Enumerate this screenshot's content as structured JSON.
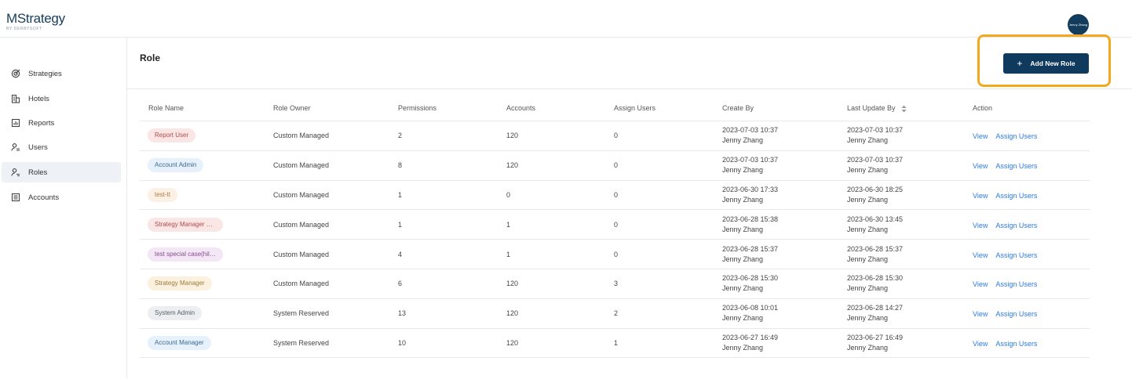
{
  "header": {
    "logo_text": "MStrategy",
    "logo_sub": "BY DERBYSOFT",
    "avatar_text": "Jenny Zhang"
  },
  "sidebar": {
    "items": [
      {
        "label": "Strategies",
        "icon": "target-icon",
        "active": false
      },
      {
        "label": "Hotels",
        "icon": "building-icon",
        "active": false
      },
      {
        "label": "Reports",
        "icon": "chart-icon",
        "active": false
      },
      {
        "label": "Users",
        "icon": "user-list-icon",
        "active": false
      },
      {
        "label": "Roles",
        "icon": "user-role-icon",
        "active": true
      },
      {
        "label": "Accounts",
        "icon": "ledger-icon",
        "active": false
      }
    ]
  },
  "page": {
    "title": "Role",
    "add_button_label": "Add New Role",
    "add_button_icon": "plus-icon",
    "highlight_color": "#f3a91d",
    "accent_color": "#0f3a5e",
    "link_color": "#2b7be4"
  },
  "table": {
    "columns": [
      "Role Name",
      "Role Owner",
      "Permissions",
      "Accounts",
      "Assign Users",
      "Create By",
      "Last Update By",
      "Action"
    ],
    "action_view": "View",
    "action_assign": "Assign Users",
    "rows": [
      {
        "role": "Report User",
        "tag_bg": "#fbe6e6",
        "tag_fg": "#b04a4a",
        "owner": "Custom Managed",
        "permissions": "2",
        "accounts": "120",
        "assign_users": "0",
        "create_time": "2023-07-03 10:37",
        "create_by": "Jenny Zhang",
        "update_time": "2023-07-03 10:37",
        "update_by": "Jenny Zhang"
      },
      {
        "role": "Account Admin",
        "tag_bg": "#e6f1fb",
        "tag_fg": "#3d6a92",
        "owner": "Custom Managed",
        "permissions": "8",
        "accounts": "120",
        "assign_users": "0",
        "create_time": "2023-07-03 10:37",
        "create_by": "Jenny Zhang",
        "update_time": "2023-07-03 10:37",
        "update_by": "Jenny Zhang"
      },
      {
        "role": "test-tt",
        "tag_bg": "#fdf0e4",
        "tag_fg": "#b07a43",
        "owner": "Custom Managed",
        "permissions": "1",
        "accounts": "0",
        "assign_users": "0",
        "create_time": "2023-06-30 17:33",
        "create_by": "Jenny Zhang",
        "update_time": "2023-06-30 18:25",
        "update_by": "Jenny Zhang"
      },
      {
        "role": "Strategy Manager Fo...",
        "tag_bg": "#fbe6e6",
        "tag_fg": "#b04a4a",
        "owner": "Custom Managed",
        "permissions": "1",
        "accounts": "1",
        "assign_users": "0",
        "create_time": "2023-06-28 15:38",
        "create_by": "Jenny Zhang",
        "update_time": "2023-06-30 13:45",
        "update_by": "Jenny Zhang"
      },
      {
        "role": "test special case(hilt...",
        "tag_bg": "#f3e6f5",
        "tag_fg": "#8a4a93",
        "owner": "Custom Managed",
        "permissions": "4",
        "accounts": "1",
        "assign_users": "0",
        "create_time": "2023-06-28 15:37",
        "create_by": "Jenny Zhang",
        "update_time": "2023-06-28 15:37",
        "update_by": "Jenny Zhang"
      },
      {
        "role": "Strategy Manager",
        "tag_bg": "#fcf1de",
        "tag_fg": "#9c7a3e",
        "owner": "Custom Managed",
        "permissions": "6",
        "accounts": "120",
        "assign_users": "3",
        "create_time": "2023-06-28 15:30",
        "create_by": "Jenny Zhang",
        "update_time": "2023-06-28 15:30",
        "update_by": "Jenny Zhang"
      },
      {
        "role": "System Admin",
        "tag_bg": "#eceef1",
        "tag_fg": "#5a6068",
        "owner": "System Reserved",
        "permissions": "13",
        "accounts": "120",
        "assign_users": "2",
        "create_time": "2023-06-08 10:01",
        "create_by": "Jenny Zhang",
        "update_time": "2023-06-28 14:27",
        "update_by": "Jenny Zhang"
      },
      {
        "role": "Account Manager",
        "tag_bg": "#e6f1fb",
        "tag_fg": "#3d6a92",
        "owner": "System Reserved",
        "permissions": "10",
        "accounts": "120",
        "assign_users": "1",
        "create_time": "2023-06-27 16:49",
        "create_by": "Jenny Zhang",
        "update_time": "2023-06-27 16:49",
        "update_by": "Jenny Zhang"
      }
    ]
  }
}
